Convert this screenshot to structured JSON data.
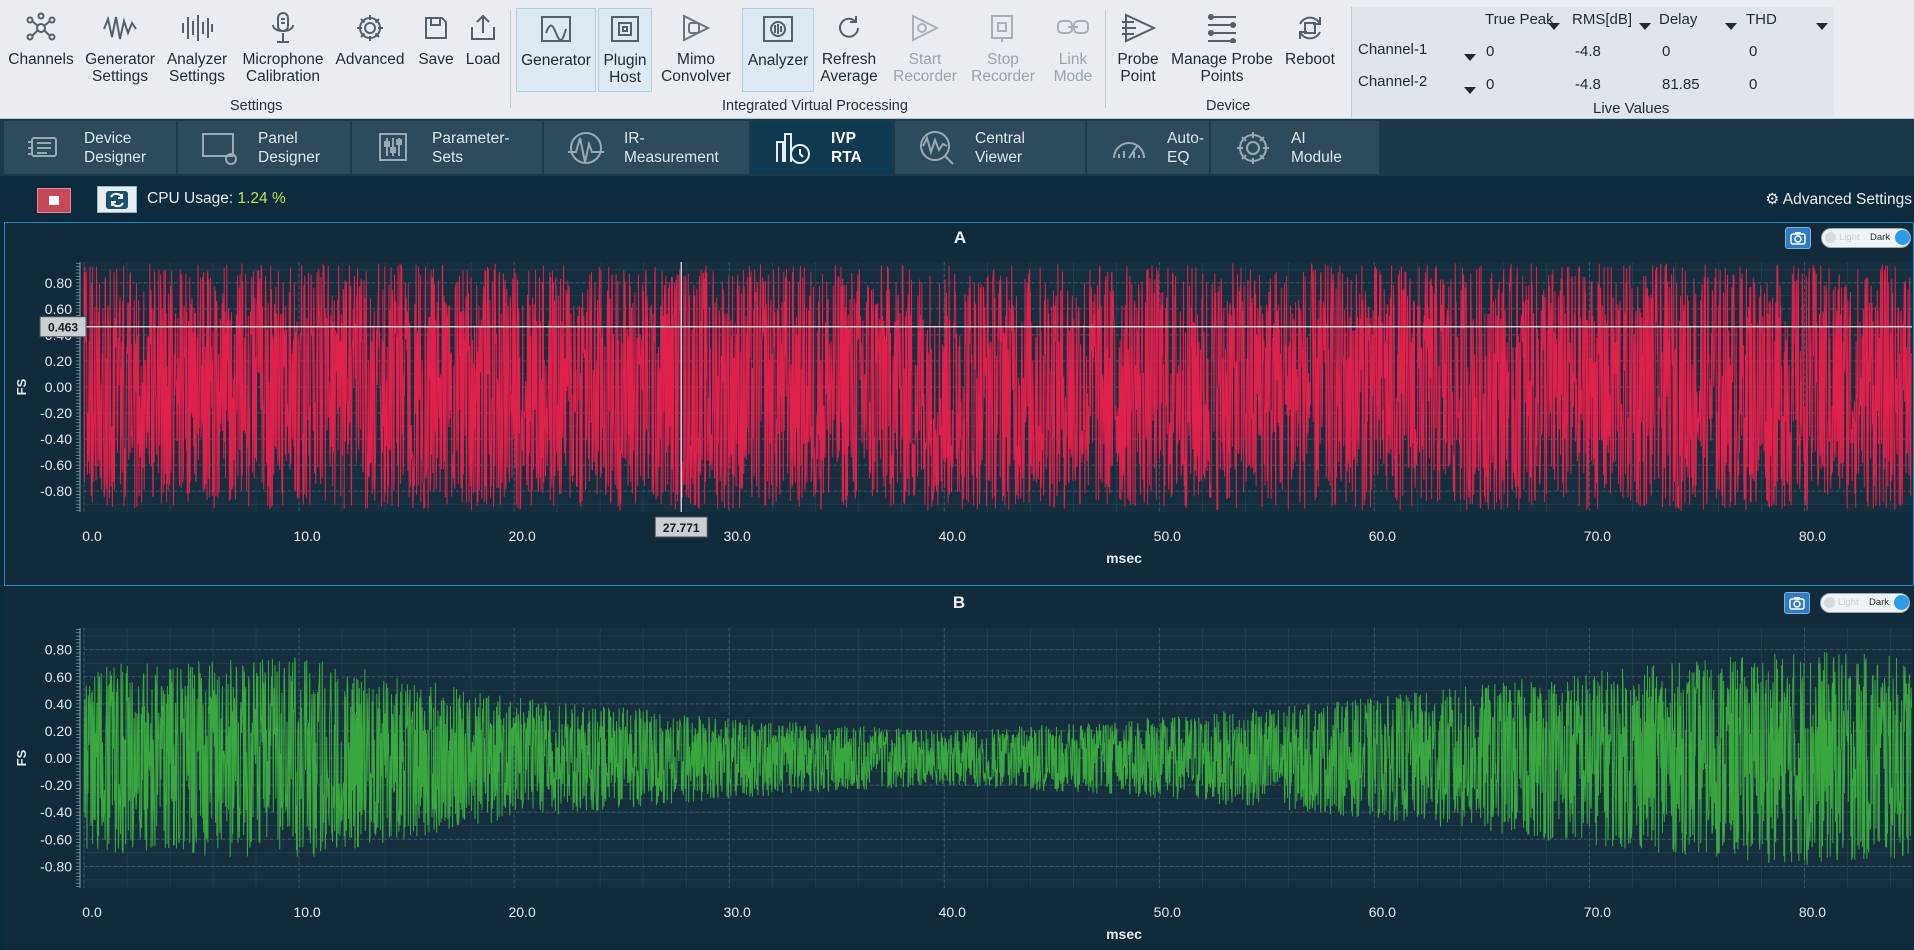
{
  "ribbon": {
    "settings_group": "Settings",
    "ivp_group": "Integrated Virtual Processing",
    "device_group": "Device",
    "buttons": {
      "channels": "Channels",
      "generator_settings_1": "Generator",
      "generator_settings_2": "Settings",
      "analyzer_settings_1": "Analyzer",
      "analyzer_settings_2": "Settings",
      "mic_cal_1": "Microphone",
      "mic_cal_2": "Calibration",
      "advanced": "Advanced",
      "save": "Save",
      "load": "Load",
      "generator": "Generator",
      "plugin_host_1": "Plugin",
      "plugin_host_2": "Host",
      "mimo_1": "Mimo",
      "mimo_2": "Convolver",
      "analyzer": "Analyzer",
      "refresh_1": "Refresh",
      "refresh_2": "Average",
      "start_rec_1": "Start",
      "start_rec_2": "Recorder",
      "stop_rec_1": "Stop",
      "stop_rec_2": "Recorder",
      "link_1": "Link",
      "link_2": "Mode",
      "probe_1": "Probe",
      "probe_2": "Point",
      "manage_probe_1": "Manage Probe",
      "manage_probe_2": "Points",
      "reboot": "Reboot"
    },
    "live_values": {
      "title": "Live Values",
      "headers": [
        "True Peak",
        "RMS[dB]",
        "Delay",
        "THD"
      ],
      "rows": [
        {
          "name": "Channel-1",
          "true_peak": "0",
          "rms": "-4.8",
          "delay": "0",
          "thd": "0"
        },
        {
          "name": "Channel-2",
          "true_peak": "0",
          "rms": "-4.8",
          "delay": "81.85",
          "thd": "0"
        }
      ]
    }
  },
  "tabs": [
    {
      "l1": "Device",
      "l2": "Designer"
    },
    {
      "l1": "Panel",
      "l2": "Designer"
    },
    {
      "l1": "Parameter-",
      "l2": "Sets"
    },
    {
      "l1": "IR-",
      "l2": "Measurement"
    },
    {
      "l1": "IVP",
      "l2": "RTA"
    },
    {
      "l1": "Central",
      "l2": "Viewer"
    },
    {
      "l1": "Auto-",
      "l2": "EQ"
    },
    {
      "l1": "AI",
      "l2": "Module"
    }
  ],
  "strip": {
    "cpu_label": "CPU Usage:",
    "cpu_value": "1.24",
    "cpu_unit": "%",
    "advanced_settings": "Advanced Settings"
  },
  "toggle": {
    "light": "Light",
    "dark": "Dark"
  },
  "colors": {
    "channel_a": "#e0204d",
    "channel_b": "#3aa83f"
  },
  "chart_data": [
    {
      "type": "line",
      "title": "A",
      "xlabel": "msec",
      "ylabel": "FS",
      "xlim": [
        0,
        85
      ],
      "ylim": [
        -0.96,
        0.96
      ],
      "yticks": [
        "0.80",
        "0.60",
        "0.40",
        "0.20",
        "0.00",
        "-0.20",
        "-0.40",
        "-0.60",
        "-0.80"
      ],
      "ytick_values": [
        0.8,
        0.6,
        0.4,
        0.2,
        0.0,
        -0.2,
        -0.4,
        -0.6,
        -0.8
      ],
      "xticks": [
        "0.0",
        "10.0",
        "20.0",
        "30.0",
        "40.0",
        "50.0",
        "60.0",
        "70.0",
        "80.0"
      ],
      "xtick_values": [
        0,
        10,
        20,
        30,
        40,
        50,
        60,
        70,
        80
      ],
      "cursor": {
        "x": 27.771,
        "y": 0.463,
        "x_label": "27.771",
        "y_label": "0.463"
      },
      "series": [
        {
          "color": "#e0204d",
          "amplitude_envelope": [
            [
              0,
              0.95
            ],
            [
              85,
              0.95
            ]
          ]
        }
      ]
    },
    {
      "type": "line",
      "title": "B",
      "xlabel": "msec",
      "ylabel": "FS",
      "xlim": [
        0,
        85
      ],
      "ylim": [
        -0.96,
        0.96
      ],
      "yticks": [
        "0.80",
        "0.60",
        "0.40",
        "0.20",
        "0.00",
        "-0.20",
        "-0.40",
        "-0.60",
        "-0.80"
      ],
      "ytick_values": [
        0.8,
        0.6,
        0.4,
        0.2,
        0.0,
        -0.2,
        -0.4,
        -0.6,
        -0.8
      ],
      "xticks": [
        "0.0",
        "10.0",
        "20.0",
        "30.0",
        "40.0",
        "50.0",
        "60.0",
        "70.0",
        "80.0"
      ],
      "xtick_values": [
        0,
        10,
        20,
        30,
        40,
        50,
        60,
        70,
        80
      ],
      "series": [
        {
          "color": "#3aa83f",
          "amplitude_envelope": [
            [
              0,
              0.7
            ],
            [
              10,
              0.75
            ],
            [
              20,
              0.45
            ],
            [
              30,
              0.3
            ],
            [
              40,
              0.2
            ],
            [
              50,
              0.3
            ],
            [
              60,
              0.45
            ],
            [
              70,
              0.65
            ],
            [
              80,
              0.8
            ],
            [
              85,
              0.75
            ]
          ]
        }
      ]
    }
  ]
}
